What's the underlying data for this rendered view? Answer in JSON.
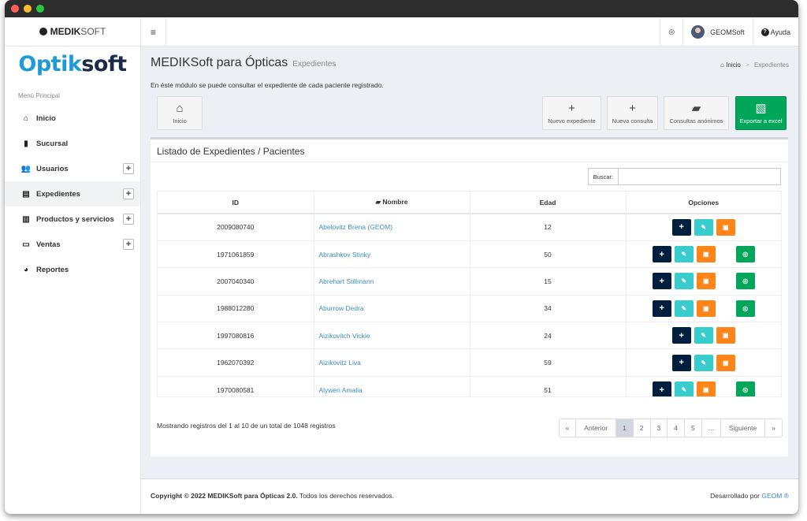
{
  "window": {
    "buttons": [
      {
        "name": "close",
        "color": "#ff5f57"
      },
      {
        "name": "minimize",
        "color": "#febc2e"
      },
      {
        "name": "zoom",
        "color": "#28c840"
      }
    ]
  },
  "sidebar": {
    "brand_bold": "MEDIK",
    "brand_light": "SOFT",
    "logo_a": "Optik",
    "logo_b": "soft",
    "heading": "Menú Principal",
    "items": [
      {
        "label": "Inicio",
        "icon": "home-icon",
        "glyph": "⌂",
        "expandable": false,
        "active": false
      },
      {
        "label": "Sucursal",
        "icon": "building-icon",
        "glyph": "▮",
        "expandable": false,
        "active": false
      },
      {
        "label": "Usuarios",
        "icon": "users-icon",
        "glyph": "👥",
        "expandable": true,
        "active": false
      },
      {
        "label": "Expedientes",
        "icon": "file-icon",
        "glyph": "▤",
        "expandable": true,
        "active": true
      },
      {
        "label": "Productos y servicios",
        "icon": "briefcase-icon",
        "glyph": "▥",
        "expandable": true,
        "active": false
      },
      {
        "label": "Ventas",
        "icon": "card-icon",
        "glyph": "▭",
        "expandable": true,
        "active": false
      },
      {
        "label": "Reportes",
        "icon": "piechart-icon",
        "glyph": "◕",
        "expandable": false,
        "active": false
      }
    ],
    "expand_symbol": "+"
  },
  "topbar": {
    "menu_icon": "≡",
    "whatsapp_icon": "◎",
    "user_name": "GEOMSoft",
    "help_label": "Ayuda",
    "help_icon": "?"
  },
  "page": {
    "title": "MEDIKSoft para Ópticas",
    "subtitle": "Expedientes",
    "breadcrumb_home": "Inicio",
    "breadcrumb_sep": ">",
    "breadcrumb_current": "Expedientes",
    "description": "En éste módulo se puede consultar el expediente de cada paciente registrado."
  },
  "actions": {
    "inicio": "Inicio",
    "nuevo_expediente": "Nuevo expediente",
    "nueva_consulta": "Nueva consulta",
    "consultas_anonimos": "Consultas anónimos",
    "exportar_excel": "Exportar a excel"
  },
  "panel": {
    "title": "Listado de Expedientes / Pacientes",
    "search_label": "Buscar:",
    "search_value": "",
    "columns": [
      "ID",
      "Nombre",
      "Edad",
      "Opciones"
    ],
    "rows": [
      {
        "id": "2009080740",
        "nombre": "Abelovitz Brena (GEOM)",
        "edad": "12",
        "whatsapp": false
      },
      {
        "id": "1971061859",
        "nombre": "Abrashkov Stinky",
        "edad": "50",
        "whatsapp": true
      },
      {
        "id": "2007040340",
        "nombre": "Abrehart Stillmann",
        "edad": "15",
        "whatsapp": true
      },
      {
        "id": "1988012280",
        "nombre": "Aburrow Dedra",
        "edad": "34",
        "whatsapp": true
      },
      {
        "id": "1997080816",
        "nombre": "Aizikovitch Vickie",
        "edad": "24",
        "whatsapp": false
      },
      {
        "id": "1962070392",
        "nombre": "Aizikovitz Liva",
        "edad": "59",
        "whatsapp": false
      },
      {
        "id": "1970080581",
        "nombre": "Alywen Amalia",
        "edad": "51",
        "whatsapp": true
      }
    ],
    "info": "Mostrando registros del 1 al 10 de un total de 1048 registros",
    "pagination": {
      "first": "«",
      "prev": "Anterior",
      "pages": [
        "1",
        "2",
        "3",
        "4",
        "5",
        "..."
      ],
      "current": "1",
      "next": "Siguiente",
      "last": "»"
    }
  },
  "footer": {
    "copyright_prefix": "Copyright © 2022",
    "product": "MEDIKSoft para Ópticas 2.0.",
    "rights": "Todos los derechos reservados.",
    "dev_prefix": "Desarrollado por",
    "dev_name": "GEOM ®"
  },
  "colors": {
    "accent_link": "#3c8dbc",
    "excel_green": "#00a65a",
    "navy": "#001f3f",
    "teal": "#39cccc",
    "orange": "#ff851b"
  }
}
